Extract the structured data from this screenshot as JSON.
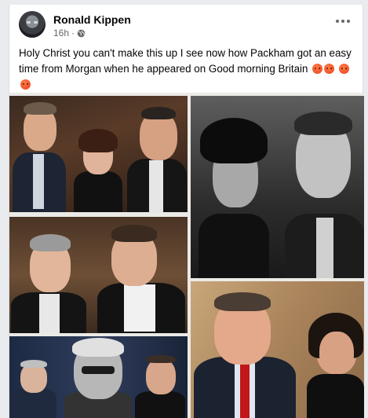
{
  "post": {
    "author": "Ronald Kippen",
    "time": "16h",
    "separator": "·",
    "privacy_icon": "globe-icon",
    "menu_icon": "more-options-icon",
    "text": "Holy Christ you can't make this up I see now how Packham got an easy time from Morgan when he appeared on Good morning Britain",
    "emoji": "angry-face-emoji",
    "emoji_count": 4
  },
  "colors": {
    "card_bg": "#ffffff",
    "page_bg": "#e9ebee",
    "secondary_text": "#65676b",
    "emoji_orange": "#e8401c"
  },
  "collage": {
    "photos": [
      "photo-group-three-people-formal",
      "photo-black-white-two-men",
      "photo-two-men-bowtie-library",
      "photo-man-red-tie-woman",
      "photo-three-men-montage"
    ]
  }
}
